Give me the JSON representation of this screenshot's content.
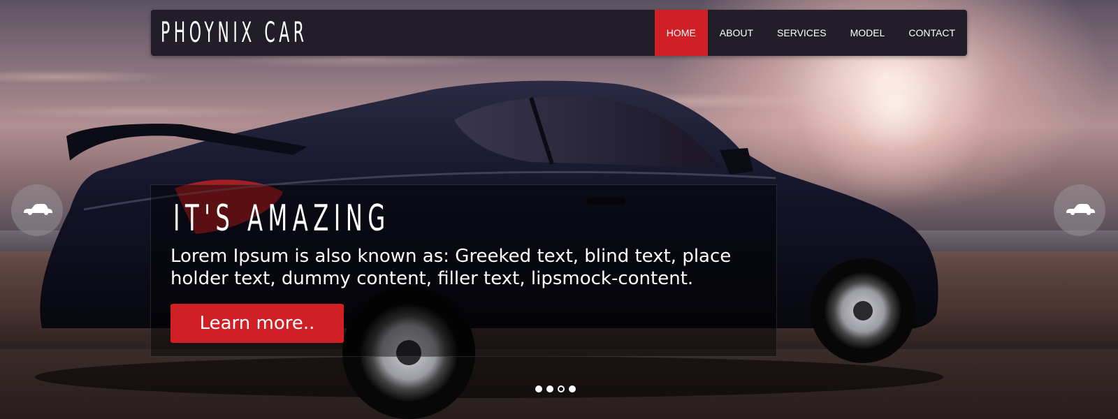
{
  "brand": {
    "name": "PHOYNIX CAR"
  },
  "nav": {
    "items": [
      {
        "label": "HOME",
        "active": true
      },
      {
        "label": "ABOUT",
        "active": false
      },
      {
        "label": "SERVICES",
        "active": false
      },
      {
        "label": "MODEL",
        "active": false
      },
      {
        "label": "CONTACT",
        "active": false
      }
    ]
  },
  "slide": {
    "title": "IT'S AMAZING",
    "text": "Lorem Ipsum is also known as: Greeked text, blind text, place holder text, dummy content, filler text, lipsmock-content.",
    "button_label": "Learn more.."
  },
  "slider": {
    "prev_icon": "car-icon",
    "next_icon": "car-icon",
    "dots": [
      {
        "active": false
      },
      {
        "active": false
      },
      {
        "active": true
      },
      {
        "active": false
      }
    ]
  },
  "colors": {
    "accent": "#d11f26",
    "navbar": "#211d29",
    "text": "#ffffff"
  }
}
